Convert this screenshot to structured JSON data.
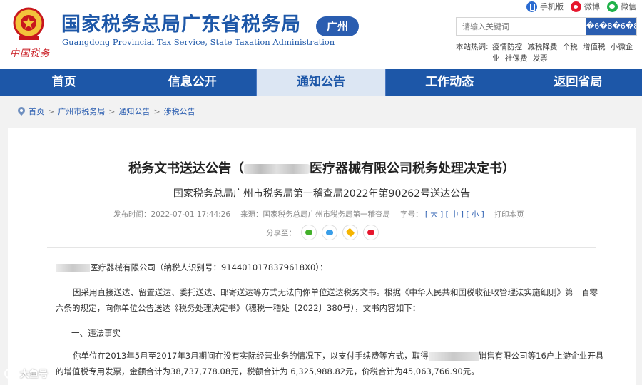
{
  "header": {
    "title": "国家税务总局广东省税务局",
    "subtitle": "Guangdong Provincial Tax Service, State Taxation Administration",
    "region_badge": "广州",
    "logo_script": "中国税务"
  },
  "top_links": [
    {
      "label": "手机版",
      "icon": "mobile-icon"
    },
    {
      "label": "微博",
      "icon": "weibo-icon"
    },
    {
      "label": "微信",
      "icon": "wechat-icon"
    }
  ],
  "search": {
    "placeholder": "请输入关键词",
    "button_label": "�6�8�6�8"
  },
  "hot": {
    "label": "本站热词:",
    "words": [
      "疫情防控",
      "减税降费",
      "个税",
      "增值税",
      "小微企业",
      "社保费",
      "发票"
    ]
  },
  "nav": [
    {
      "label": "首页"
    },
    {
      "label": "信息公开"
    },
    {
      "label": "通知公告"
    },
    {
      "label": "工作动态"
    },
    {
      "label": "返回省局"
    }
  ],
  "breadcrumb": [
    "首页",
    "广州市税务局",
    "通知公告",
    "涉税公告"
  ],
  "article": {
    "title_prefix": "税务文书送达公告（",
    "title_suffix": "医疗器械有限公司税务处理决定书）",
    "subtitle": "国家税务总局广州市税务局第一稽查局2022年第90262号送达公告",
    "meta": {
      "publish_label": "发布时间：",
      "publish_time": "2022-07-01 17:44:26",
      "source_label": "来源：",
      "source": "国家税务总局广州市税务局第一稽查局",
      "font_label": "字号：",
      "font_large": "[ 大 ]",
      "font_medium": "[ 中 ]",
      "font_small": "[ 小 ]",
      "print": "打印本页"
    },
    "share_label": "分享至：",
    "p1": "医疗器械有限公司（纳税人识别号：9144010178379618X0）：",
    "p2": "因采用直接送达、留置送达、委托送达、邮寄送达等方式无法向你单位送达税务文书。根据《中华人民共和国税收征收管理法实施细则》第一百零六条的规定，向你单位公告送达《税务处理决定书》（穗税一稽处〔2022〕380号），文书内容如下：",
    "p3": "一、违法事实",
    "p4_a": "你单位在2013年5月至2017年3月期间在没有实际经营业务的情况下，以支付手续费等方式，取得",
    "p4_b": "销售有限公司等16户上游企业",
    "p4_c": "开具的增值税专用发票，金额合计为38,737,778.08元，税额合计为 6,325,988.82元，价税合计为45,063,766.90元。"
  },
  "watermark": "大鱼号"
}
